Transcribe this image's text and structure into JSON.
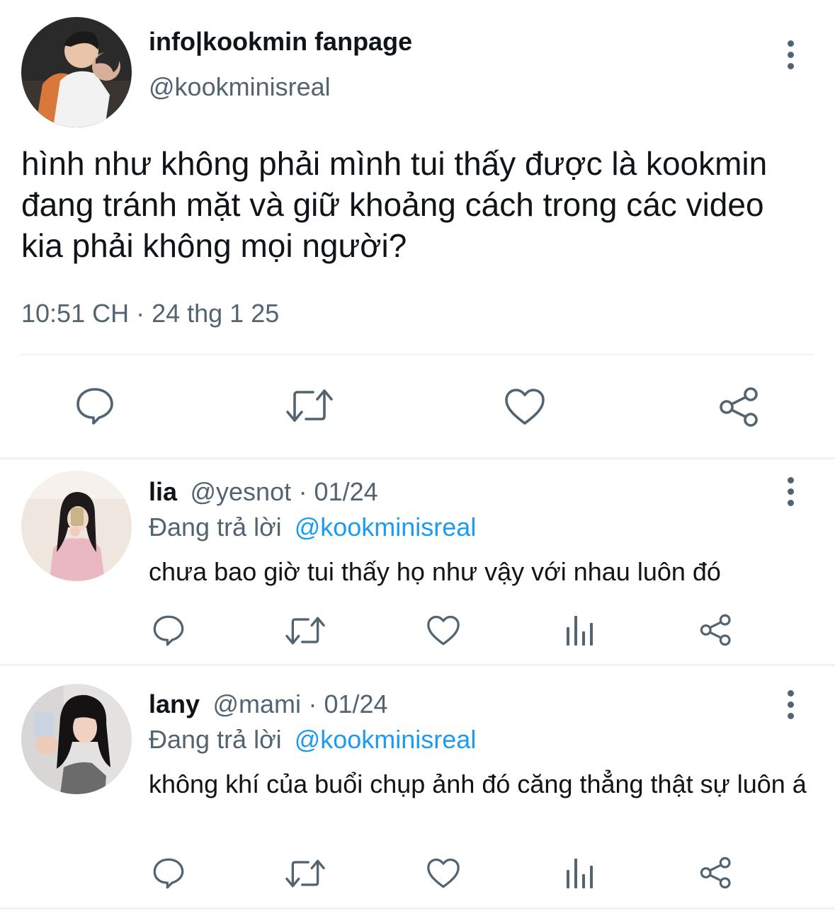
{
  "main_tweet": {
    "display_name": "info|kookmin fanpage",
    "handle": "@kookminisreal",
    "text": "hình như không phải mình tui thấy được là kookmin đang tránh mặt và giữ khoảng cách trong các video kia phải không mọi người?",
    "timestamp": "10:51 CH · 24 thg 1 25",
    "actions": [
      "reply-icon",
      "retweet-icon",
      "like-icon",
      "share-icon"
    ]
  },
  "replies": [
    {
      "display_name": "lia",
      "handle": "@yesnot",
      "date": "· 01/24",
      "replying_label": "Đang trả lời",
      "replying_to": "@kookminisreal",
      "text": "chưa bao giờ tui thấy họ như vậy với nhau luôn đó",
      "actions": [
        "reply-icon",
        "retweet-icon",
        "like-icon",
        "analytics-icon",
        "share-icon"
      ]
    },
    {
      "display_name": "lany",
      "handle": "@mami",
      "date": "· 01/24",
      "replying_label": "Đang trả lời",
      "replying_to": "@kookminisreal",
      "text": "không khí của buổi chụp ảnh đó căng thẳng thật sự luôn á",
      "actions": [
        "reply-icon",
        "retweet-icon",
        "like-icon",
        "analytics-icon",
        "share-icon"
      ]
    }
  ],
  "colors": {
    "text_primary": "#0f1419",
    "text_secondary": "#536471",
    "mention": "#1d9bf0",
    "divider": "#eff3f4"
  }
}
